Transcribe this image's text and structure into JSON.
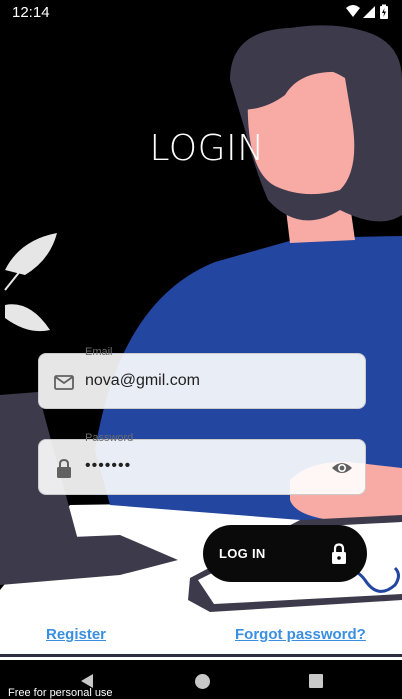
{
  "status_bar": {
    "time": "12:14"
  },
  "screen": {
    "title": "LOGIN"
  },
  "email_field": {
    "label": "Email",
    "value": "nova@gmil.com"
  },
  "password_field": {
    "label": "Password",
    "value": "•••••••"
  },
  "login_button": {
    "label": "LOG IN"
  },
  "links": {
    "register": "Register",
    "forgot_password": "Forgot password?"
  },
  "watermark": "Free for personal use",
  "colors": {
    "background": "#000000",
    "shirt": "#2346a0",
    "hair": "#3d3a4b",
    "skin": "#f8aaa5",
    "link": "#3a8fe0",
    "button": "#0a0a0a"
  },
  "icons": [
    "wifi-icon",
    "signal-icon",
    "battery-icon",
    "mail-icon",
    "lock-icon",
    "eye-icon",
    "lock-button-icon",
    "nav-back-icon",
    "nav-home-icon",
    "nav-recents-icon"
  ]
}
